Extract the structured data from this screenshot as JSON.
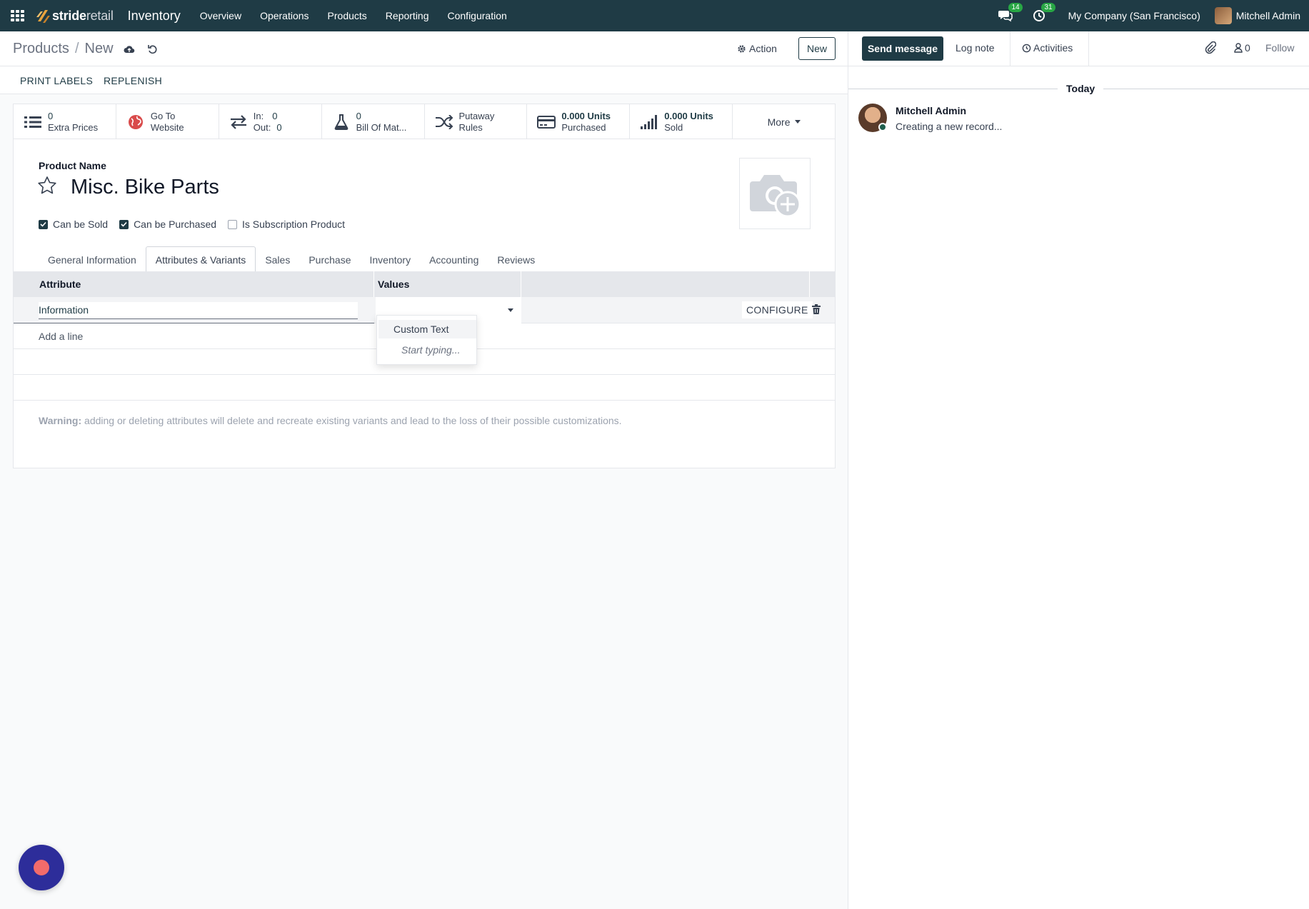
{
  "navbar": {
    "brand_bold": "stride",
    "brand_light": "retail",
    "app_name": "Inventory",
    "menu": [
      "Overview",
      "Operations",
      "Products",
      "Reporting",
      "Configuration"
    ],
    "messages_count": "14",
    "activities_count": "31",
    "company": "My Company (San Francisco)",
    "user": "Mitchell Admin"
  },
  "control_panel": {
    "breadcrumb_parent": "Products",
    "breadcrumb_separator": "/",
    "breadcrumb_current": "New",
    "action_label": "Action",
    "new_label": "New"
  },
  "buttonbar": {
    "print_labels": "PRINT LABELS",
    "replenish": "REPLENISH"
  },
  "stats": {
    "extra_prices": {
      "value": "0",
      "label": "Extra Prices"
    },
    "website": {
      "line1": "Go To",
      "line2": "Website"
    },
    "in_out": {
      "in_label": "In:",
      "in_value": "0",
      "out_label": "Out:",
      "out_value": "0"
    },
    "bom": {
      "value": "0",
      "label": "Bill Of Mat..."
    },
    "putaway": {
      "line1": "Putaway",
      "line2": "Rules"
    },
    "purchased": {
      "value": "0.000 Units",
      "label": "Purchased"
    },
    "sold": {
      "value": "0.000 Units",
      "label": "Sold"
    },
    "more": "More"
  },
  "product": {
    "name_label": "Product Name",
    "name": "Misc. Bike Parts",
    "can_be_sold": {
      "label": "Can be Sold",
      "checked": true
    },
    "can_be_purchased": {
      "label": "Can be Purchased",
      "checked": true
    },
    "is_subscription": {
      "label": "Is Subscription Product",
      "checked": false
    }
  },
  "tabs": [
    "General Information",
    "Attributes & Variants",
    "Sales",
    "Purchase",
    "Inventory",
    "Accounting",
    "Reviews"
  ],
  "active_tab": "Attributes & Variants",
  "table": {
    "col_attribute": "Attribute",
    "col_values": "Values",
    "row_attribute": "Information",
    "configure": "CONFIGURE",
    "add_line": "Add a line"
  },
  "dropdown": {
    "item": "Custom Text",
    "hint": "Start typing..."
  },
  "warning": {
    "label": "Warning:",
    "text": " adding or deleting attributes will delete and recreate existing variants and lead to the loss of their possible customizations."
  },
  "chatter": {
    "send_message": "Send message",
    "log_note": "Log note",
    "activities": "Activities",
    "followers_count": "0",
    "follow": "Follow",
    "today": "Today",
    "message_author": "Mitchell Admin",
    "message_body": "Creating a new record..."
  },
  "colors": {
    "navbar_bg": "#1f3b45",
    "accent": "#1f3b45",
    "badge": "#28a745",
    "fab": "#2d2d9a"
  }
}
